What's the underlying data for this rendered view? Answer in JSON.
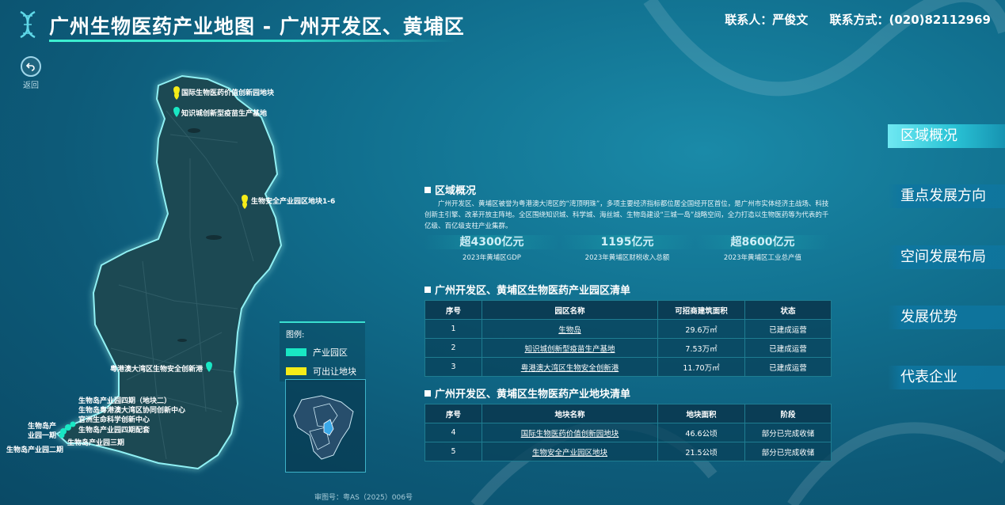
{
  "header": {
    "title": "广州生物医药产业地图 - 广州开发区、黄埔区",
    "contact_person": "联系人：严俊文",
    "contact_phone": "联系方式：(020)82112969"
  },
  "back": {
    "label": "返回"
  },
  "map": {
    "markers": [
      {
        "label": "国际生物医药价值创新园地块",
        "type": "plot"
      },
      {
        "label": "知识城创新型疫苗生产基地",
        "type": "park"
      },
      {
        "label": "生物安全产业园区地块1-6",
        "type": "plot"
      },
      {
        "label": "粤港澳大湾区生物安全创新港",
        "type": "park"
      },
      {
        "label": "生物岛产业园四期（地块二）",
        "type": "text"
      },
      {
        "label": "生物岛粤港澳大湾区协同创新中心",
        "type": "text"
      },
      {
        "label": "官洲生命科学创新中心",
        "type": "text"
      },
      {
        "label": "生物岛产业园四期配套",
        "type": "text"
      },
      {
        "label": "生物岛产",
        "type": "text"
      },
      {
        "label": "业园一期",
        "type": "text"
      },
      {
        "label": "生物岛产业园三期",
        "type": "text"
      },
      {
        "label": "生物岛产业园二期",
        "type": "text"
      }
    ],
    "legend": {
      "title": "图例:",
      "items": [
        {
          "label": "产业园区",
          "color": "#19e7c4"
        },
        {
          "label": "可出让地块",
          "color": "#f5ec18"
        }
      ]
    },
    "review_no": "审图号：粤AS（2025）006号"
  },
  "overview": {
    "title": "区域概况",
    "text": "广州开发区、黄埔区被誉为粤港澳大湾区的“湾顶明珠”，多项主要经济指标都位居全国经开区首位，是广州市实体经济主战场、科技创新主引擎、改革开放主阵地。全区围绕知识城、科学城、海丝城、生物岛建设“三城一岛”战略空间，全力打造以生物医药等为代表的千亿级、百亿级支柱产业集群。",
    "stats": [
      {
        "value": "超4300亿元",
        "label": "2023年黄埔区GDP"
      },
      {
        "value": "1195亿元",
        "label": "2023年黄埔区财税收入总额"
      },
      {
        "value": "超8600亿元",
        "label": "2023年黄埔区工业总产值"
      }
    ]
  },
  "parks": {
    "title": "广州开发区、黄埔区生物医药产业园区清单",
    "headers": [
      "序号",
      "园区名称",
      "可招商建筑面积",
      "状态"
    ],
    "rows": [
      [
        "1",
        "生物岛",
        "29.6万㎡",
        "已建成运营"
      ],
      [
        "2",
        "知识城创新型疫苗生产基地",
        "7.53万㎡",
        "已建成运营"
      ],
      [
        "3",
        "粤港澳大湾区生物安全创新港",
        "11.70万㎡",
        "已建成运营"
      ]
    ]
  },
  "plots": {
    "title": "广州开发区、黄埔区生物医药产业地块清单",
    "headers": [
      "序号",
      "地块名称",
      "地块面积",
      "阶段"
    ],
    "rows": [
      [
        "4",
        "国际生物医药价值创新园地块",
        "46.6公顷",
        "部分已完成收储"
      ],
      [
        "5",
        "生物安全产业园区地块",
        "21.5公顷",
        "部分已完成收储"
      ]
    ]
  },
  "nav": {
    "active": "区域概况",
    "items": [
      "区域概况",
      "重点发展方向",
      "空间发展布局",
      "发展优势",
      "代表企业"
    ]
  },
  "colors": {
    "park": "#19e7c4",
    "plot": "#f5ec18",
    "accent": "#3adfd0"
  }
}
